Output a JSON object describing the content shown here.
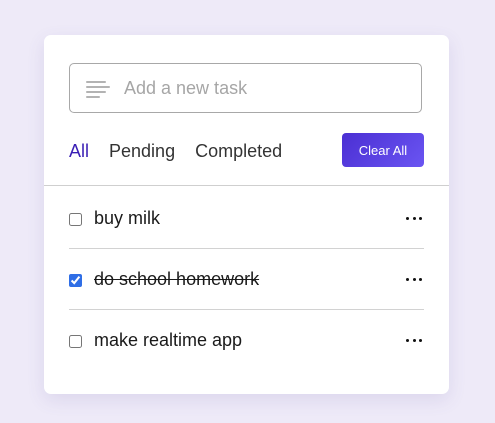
{
  "input": {
    "placeholder": "Add a new task",
    "icon": "text-align-left-icon"
  },
  "filters": [
    {
      "label": "All",
      "active": true
    },
    {
      "label": "Pending",
      "active": false
    },
    {
      "label": "Completed",
      "active": false
    }
  ],
  "clear_button": {
    "label": "Clear All"
  },
  "tasks": [
    {
      "label": "buy milk",
      "checked": false
    },
    {
      "label": "do school homework",
      "checked": true
    },
    {
      "label": "make realtime app",
      "checked": false
    }
  ],
  "colors": {
    "background": "#eeeaf8",
    "accent": "#3a1fb5",
    "button_gradient_start": "#4b2fd3",
    "button_gradient_end": "#6a55f2"
  }
}
